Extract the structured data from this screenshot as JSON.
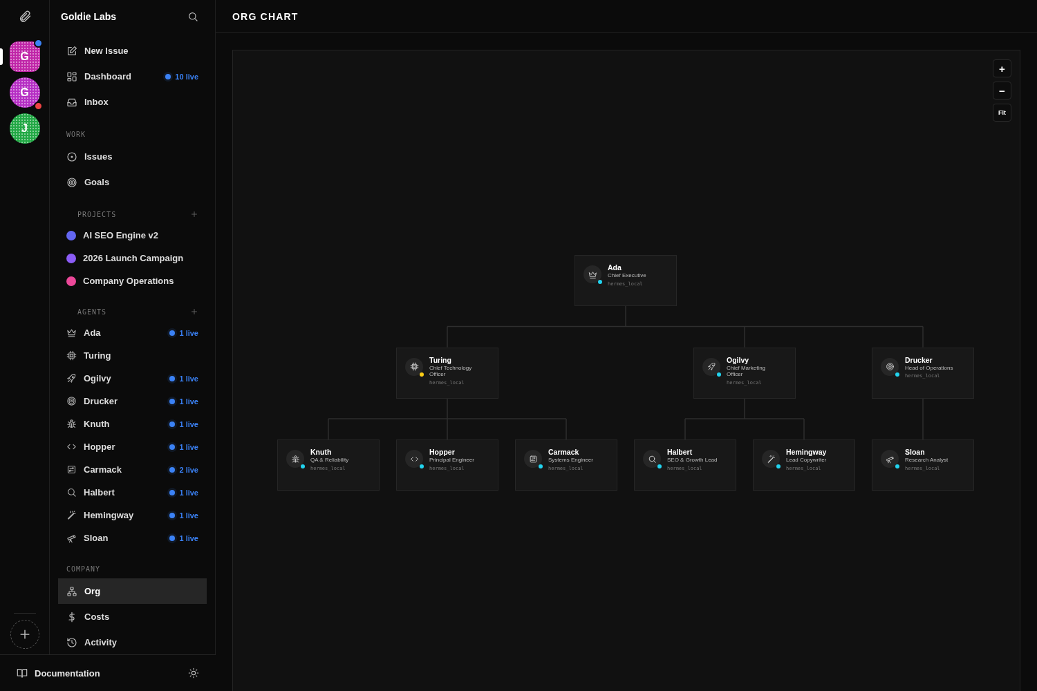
{
  "rail": {
    "avatars": [
      {
        "letter": "G",
        "selected": true,
        "color": "#c026a8",
        "badge": {
          "color": "#3b82f6"
        }
      },
      {
        "letter": "G",
        "selected": false,
        "color": "#b62fc4",
        "badge": {
          "color": "#ef4444"
        }
      },
      {
        "letter": "J",
        "selected": false,
        "color": "#22a845"
      }
    ]
  },
  "sidebar": {
    "workspace": "Goldie Labs",
    "top_items": [
      {
        "label": "New Issue",
        "selected": false
      },
      {
        "label": "Dashboard",
        "selected": false,
        "badge": "10 live"
      },
      {
        "label": "Inbox",
        "selected": false
      }
    ],
    "sections": [
      {
        "kind": "nav",
        "title": "WORK",
        "addable": false,
        "items": [
          {
            "label": "Issues",
            "selected": false
          },
          {
            "label": "Goals",
            "selected": false
          }
        ]
      },
      {
        "kind": "projects",
        "title": "PROJECTS",
        "addable": true,
        "items": [
          {
            "label": "AI SEO Engine v2",
            "selected": false,
            "color": "#6366f1"
          },
          {
            "label": "2026 Launch Campaign",
            "selected": false,
            "color": "#8b5cf6"
          },
          {
            "label": "Company Operations",
            "selected": false,
            "color": "#ec4899"
          }
        ]
      },
      {
        "kind": "agents",
        "title": "AGENTS",
        "addable": true,
        "items": [
          {
            "label": "Ada",
            "selected": false,
            "badge": "1 live"
          },
          {
            "label": "Turing",
            "selected": false
          },
          {
            "label": "Ogilvy",
            "selected": false,
            "badge": "1 live"
          },
          {
            "label": "Drucker",
            "selected": false,
            "badge": "1 live"
          },
          {
            "label": "Knuth",
            "selected": false,
            "badge": "1 live"
          },
          {
            "label": "Hopper",
            "selected": false,
            "badge": "1 live"
          },
          {
            "label": "Carmack",
            "selected": false,
            "badge": "2 live"
          },
          {
            "label": "Halbert",
            "selected": false,
            "badge": "1 live"
          },
          {
            "label": "Hemingway",
            "selected": false,
            "badge": "1 live"
          },
          {
            "label": "Sloan",
            "selected": false,
            "badge": "1 live"
          }
        ]
      },
      {
        "kind": "nav",
        "title": "COMPANY",
        "addable": false,
        "items": [
          {
            "label": "Org",
            "selected": true
          },
          {
            "label": "Costs",
            "selected": false
          },
          {
            "label": "Activity",
            "selected": false
          }
        ]
      }
    ],
    "footer": {
      "label": "Documentation"
    }
  },
  "main": {
    "title": "ORG CHART",
    "zoom_controls": [
      "+",
      "−",
      "Fit"
    ],
    "org": {
      "name": "Ada",
      "role": "Chief Executive",
      "adapter": "hermes_local",
      "color": "#22d3ee",
      "children": [
        {
          "name": "Turing",
          "role": "Chief Technology Officer",
          "adapter": "hermes_local",
          "color": "#facc15",
          "children": [
            {
              "name": "Knuth",
              "role": "QA & Reliability",
              "adapter": "hermes_local",
              "color": "#22d3ee"
            },
            {
              "name": "Hopper",
              "role": "Principal Engineer",
              "adapter": "hermes_local",
              "color": "#22d3ee"
            },
            {
              "name": "Carmack",
              "role": "Systems Engineer",
              "adapter": "hermes_local",
              "color": "#22d3ee"
            }
          ]
        },
        {
          "name": "Ogilvy",
          "role": "Chief Marketing Officer",
          "adapter": "hermes_local",
          "color": "#22d3ee",
          "children": [
            {
              "name": "Halbert",
              "role": "SEO & Growth Lead",
              "adapter": "hermes_local",
              "color": "#22d3ee"
            },
            {
              "name": "Hemingway",
              "role": "Lead Copywriter",
              "adapter": "hermes_local",
              "color": "#22d3ee"
            }
          ]
        },
        {
          "name": "Drucker",
          "role": "Head of Operations",
          "adapter": "hermes_local",
          "color": "#22d3ee",
          "children": [
            {
              "name": "Sloan",
              "role": "Research Analyst",
              "adapter": "hermes_local",
              "color": "#22d3ee"
            }
          ]
        }
      ]
    }
  }
}
